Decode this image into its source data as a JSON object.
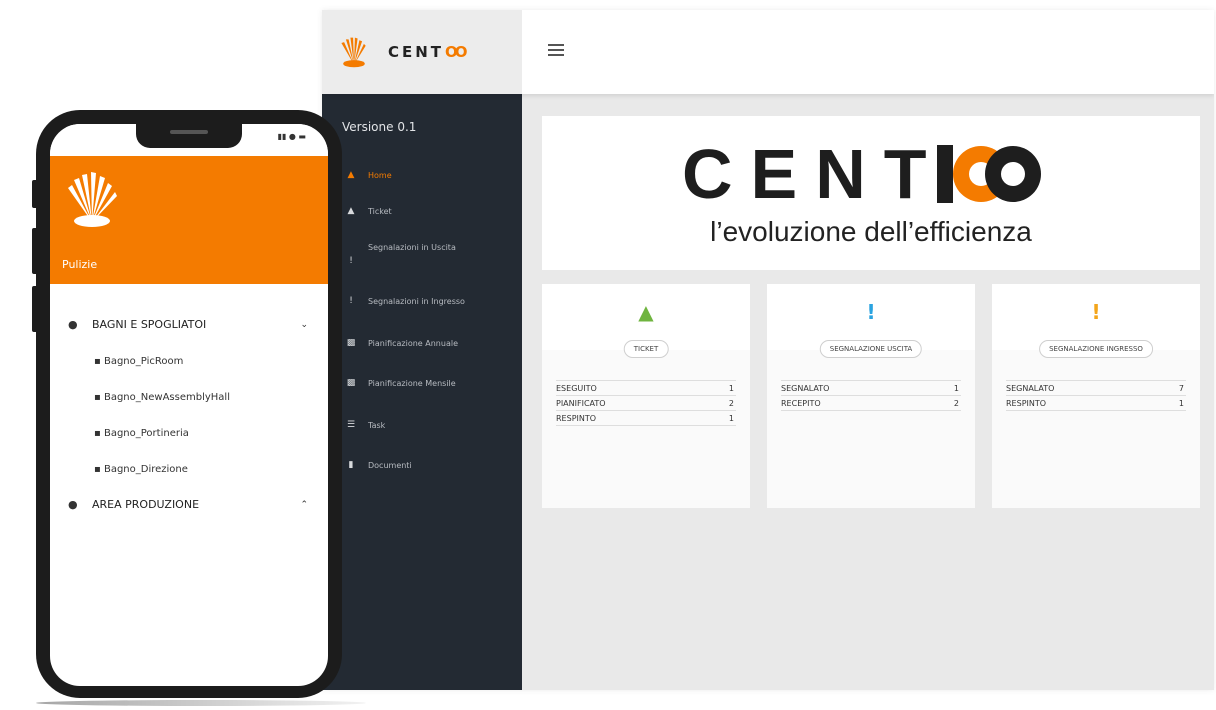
{
  "desktop": {
    "brand_name": "CENT",
    "brand_suffix": "OO",
    "menu_icon": "hamburger-icon",
    "version": "Versione 0.1",
    "sidebar": [
      {
        "label": "Home",
        "icon": "home-icon",
        "active": true
      },
      {
        "label": "Ticket",
        "icon": "bell-icon",
        "active": false
      },
      {
        "label": "Segnalazioni in Uscita",
        "icon": "exclamation-icon",
        "active": false
      },
      {
        "label": "Segnalazioni in Ingresso",
        "icon": "exclamation-icon",
        "active": false
      },
      {
        "label": "Pianificazione Annuale",
        "icon": "chart-icon",
        "active": false
      },
      {
        "label": "Pianificazione Mensile",
        "icon": "chart-icon",
        "active": false
      },
      {
        "label": "Task",
        "icon": "list-icon",
        "active": false
      },
      {
        "label": "Documenti",
        "icon": "file-icon",
        "active": false
      }
    ],
    "banner": {
      "title": "CENT",
      "title_mark": "10",
      "tagline": "l’evoluzione dell’efficienza"
    },
    "cards": [
      {
        "label": "TICKET",
        "icon": "bell-icon",
        "icon_color": "#6fb43f",
        "rows": [
          {
            "k": "ESEGUITO",
            "v": "1"
          },
          {
            "k": "PIANIFICATO",
            "v": "2"
          },
          {
            "k": "RESPINTO",
            "v": "1"
          }
        ]
      },
      {
        "label": "SEGNALAZIONE USCITA",
        "icon": "exclamation-icon",
        "icon_color": "#2aa3e0",
        "rows": [
          {
            "k": "SEGNALATO",
            "v": "1"
          },
          {
            "k": "RECEPITO",
            "v": "2"
          }
        ]
      },
      {
        "label": "SEGNALAZIONE INGRESSO",
        "icon": "exclamation-icon",
        "icon_color": "#f3a51b",
        "rows": [
          {
            "k": "SEGNALATO",
            "v": "7"
          },
          {
            "k": "RESPINTO",
            "v": "1"
          }
        ]
      }
    ]
  },
  "phone": {
    "header_title": "Pulizie",
    "accent": "#f47b00",
    "status_icons": "signal-wifi-battery",
    "groups": [
      {
        "label": "BAGNI E SPOGLIATOI",
        "chevron": "chevron-down-icon",
        "items": [
          "Bagno_PicRoom",
          "Bagno_NewAssemblyHall",
          "Bagno_Portineria",
          "Bagno_Direzione"
        ]
      },
      {
        "label": "AREA PRODUZIONE",
        "chevron": "chevron-up-icon",
        "items": []
      }
    ]
  },
  "colors": {
    "orange": "#f47b00",
    "sidebar_bg": "#232a33",
    "content_bg": "#e9e9e9"
  }
}
